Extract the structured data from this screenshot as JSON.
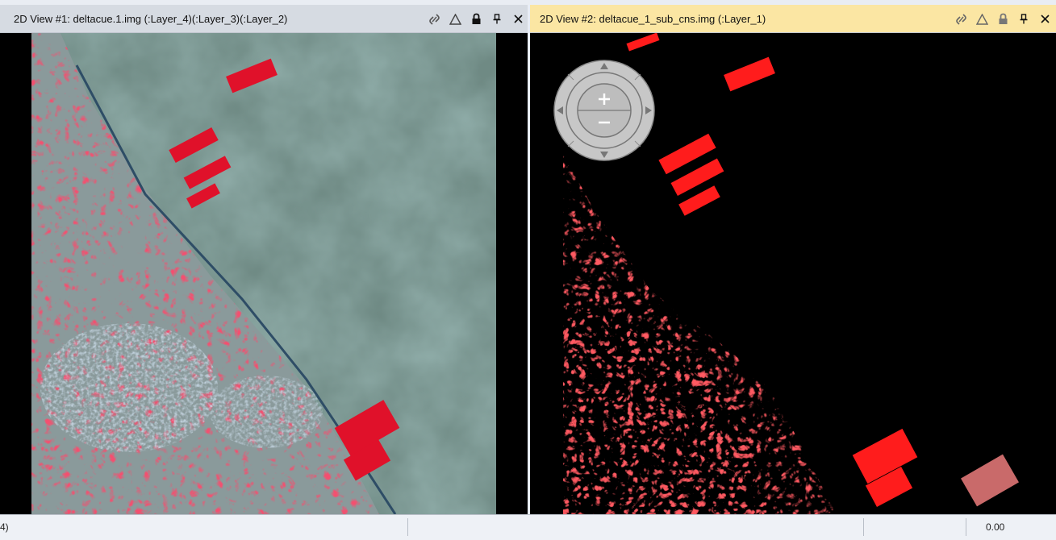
{
  "views": {
    "left": {
      "title": "2D View #1: deltacue.1.img (:Layer_4)(:Layer_3)(:Layer_2)",
      "icons": [
        "link-icon",
        "triangle-icon",
        "lock-icon",
        "pin-icon",
        "close-icon"
      ],
      "image_kind": "false-color satellite image",
      "accent": "#e8182a"
    },
    "right": {
      "title": "2D View #2: deltacue_1_sub_cns.img (:Layer_1)",
      "icons": [
        "link-icon",
        "triangle-icon",
        "lock-icon",
        "pin-icon",
        "close-icon"
      ],
      "image_kind": "classification mask",
      "accent": "#ff1c1c"
    }
  },
  "status_bar": {
    "left_text": "4)",
    "right_value": "0.00"
  },
  "colors": {
    "active_title_bg": "#fbe6a3",
    "inactive_title_bg": "#d6dbe2",
    "view_bg": "#000000"
  }
}
